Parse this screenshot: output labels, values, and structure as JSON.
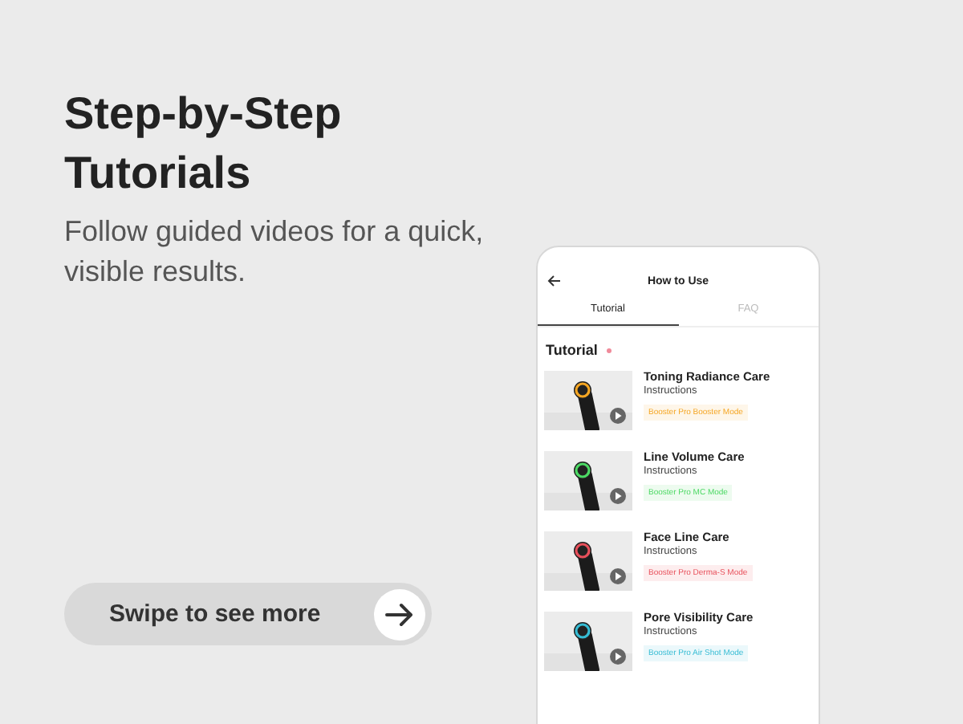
{
  "headline": "Step-by-Step Tutorials",
  "subtitle": "Follow guided videos for a quick, visible results.",
  "swipe_button": {
    "label": "Swipe to see more"
  },
  "phone": {
    "title": "How to Use",
    "tabs": [
      {
        "label": "Tutorial",
        "selected": true
      },
      {
        "label": "FAQ",
        "selected": false
      }
    ],
    "section_title": "Tutorial",
    "tutorials": [
      {
        "title": "Toning Radiance Care",
        "subtitle": "Instructions",
        "tag": "Booster Pro Booster Mode",
        "color": "#f5a623"
      },
      {
        "title": "Line Volume Care",
        "subtitle": "Instructions",
        "tag": "Booster Pro MC Mode",
        "color": "#4cd964"
      },
      {
        "title": "Face Line Care",
        "subtitle": "Instructions",
        "tag": "Booster Pro Derma-S Mode",
        "color": "#e8505b"
      },
      {
        "title": "Pore Visibility Care",
        "subtitle": "Instructions",
        "tag": "Booster Pro Air Shot Mode",
        "color": "#36bcd4"
      }
    ]
  }
}
